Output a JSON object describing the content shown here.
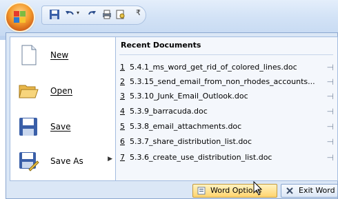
{
  "quick_access": {
    "icons": [
      "save-icon",
      "undo-icon",
      "redo-icon",
      "print-icon",
      "print-preview-icon",
      "customize-arrow-icon"
    ]
  },
  "office_menu": {
    "commands": [
      {
        "label": "New",
        "icon": "new-document-icon"
      },
      {
        "label": "Open",
        "icon": "open-folder-icon"
      },
      {
        "label": "Save",
        "icon": "save-icon"
      },
      {
        "label": "Save As",
        "icon": "save-as-icon",
        "has_submenu": true
      }
    ],
    "recent": {
      "header": "Recent Documents",
      "items": [
        {
          "num": "1",
          "name": "5.4.1_ms_word_get_rid_of_colored_lines.doc"
        },
        {
          "num": "2",
          "name": "5.3.15_send_email_from_non_rhodes_accounts..."
        },
        {
          "num": "3",
          "name": "5.3.10_Junk_Email_Outlook.doc"
        },
        {
          "num": "4",
          "name": "5.3.9_barracuda.doc"
        },
        {
          "num": "5",
          "name": "5.3.8_email_attachments.doc"
        },
        {
          "num": "6",
          "name": "5.3.7_share_distribution_list.doc"
        },
        {
          "num": "7",
          "name": "5.3.6_create_use_distribution_list.doc"
        }
      ]
    },
    "word_options_label": "Word Options",
    "exit_word_label": "Exit Word"
  },
  "colors": {
    "accent": "#f39a2c",
    "menu_bg": "#dbe7f6",
    "border": "#8ba7cf"
  }
}
